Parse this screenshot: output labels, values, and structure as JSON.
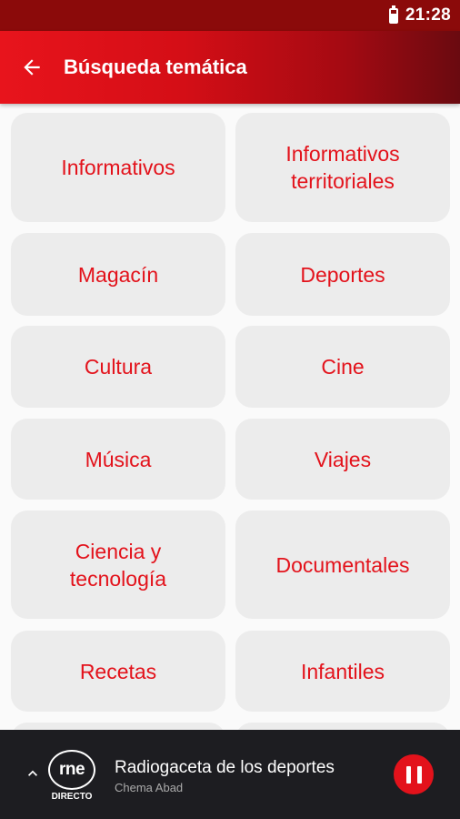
{
  "status_bar": {
    "time": "21:28",
    "battery_icon": "battery-icon"
  },
  "app_bar": {
    "title": "Búsqueda temática",
    "back_icon": "arrow-left-icon"
  },
  "categories": [
    {
      "label": "Informativos"
    },
    {
      "label": "Informativos\nterritoriales"
    },
    {
      "label": "Magacín"
    },
    {
      "label": "Deportes"
    },
    {
      "label": "Cultura"
    },
    {
      "label": "Cine"
    },
    {
      "label": "Música"
    },
    {
      "label": "Viajes"
    },
    {
      "label": "Ciencia y\ntecnología"
    },
    {
      "label": "Documentales"
    },
    {
      "label": "Recetas"
    },
    {
      "label": "Infantiles"
    }
  ],
  "player": {
    "logo_text": "rne",
    "live_label": "DIRECTO",
    "program_title": "Radiogaceta de los deportes",
    "host": "Chema Abad",
    "state": "playing"
  },
  "colors": {
    "accent": "#e3121b",
    "card_bg": "#ececec",
    "player_bg": "#1d1d21"
  }
}
